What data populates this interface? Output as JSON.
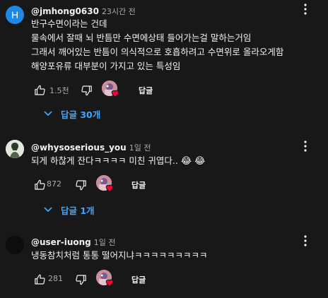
{
  "comments": [
    {
      "avatar_letter": "H",
      "avatar_color": "#1e88e5",
      "author": "@jmhong0630",
      "time": "23시간 전",
      "lines": [
        "반구수면이라는 건데",
        "물속에서 잘때 뇌 반틈만 수면에상태 들어가는걸 말하는거임",
        "그래서 깨어있는 반틈이 의식적으로 호흡하려고 수면위로 올라오게함",
        "해양포유류 대부분이 가지고 있는 특성임"
      ],
      "likes": "1.5천",
      "reply_label": "답글",
      "replies_label": "답글 30개"
    },
    {
      "author": "@whysoserious_you",
      "time": "1일 전",
      "text": "되게 하찮게 잔다ㅋㅋㅋㅋ 미친 귀엽다..",
      "emojis": "😂 😂",
      "likes": "872",
      "reply_label": "답글",
      "replies_label": "답글 1개"
    },
    {
      "author": "@user-iuong",
      "time": "1일 전",
      "text": "냉동참치처럼 통통 떨어지냐ㅋㅋㅋㅋㅋㅋㅋㅋㅋ",
      "likes": "281",
      "reply_label": "답글"
    }
  ],
  "colors": {
    "background": "#181818",
    "link_blue": "#3ea6ff",
    "secondary_text": "#aaaaaa",
    "heart_red": "#ff0033"
  },
  "icons": [
    "thumb-up-icon",
    "thumb-down-icon",
    "creator-heart-icon",
    "chevron-down-icon",
    "more-vert-icon"
  ]
}
